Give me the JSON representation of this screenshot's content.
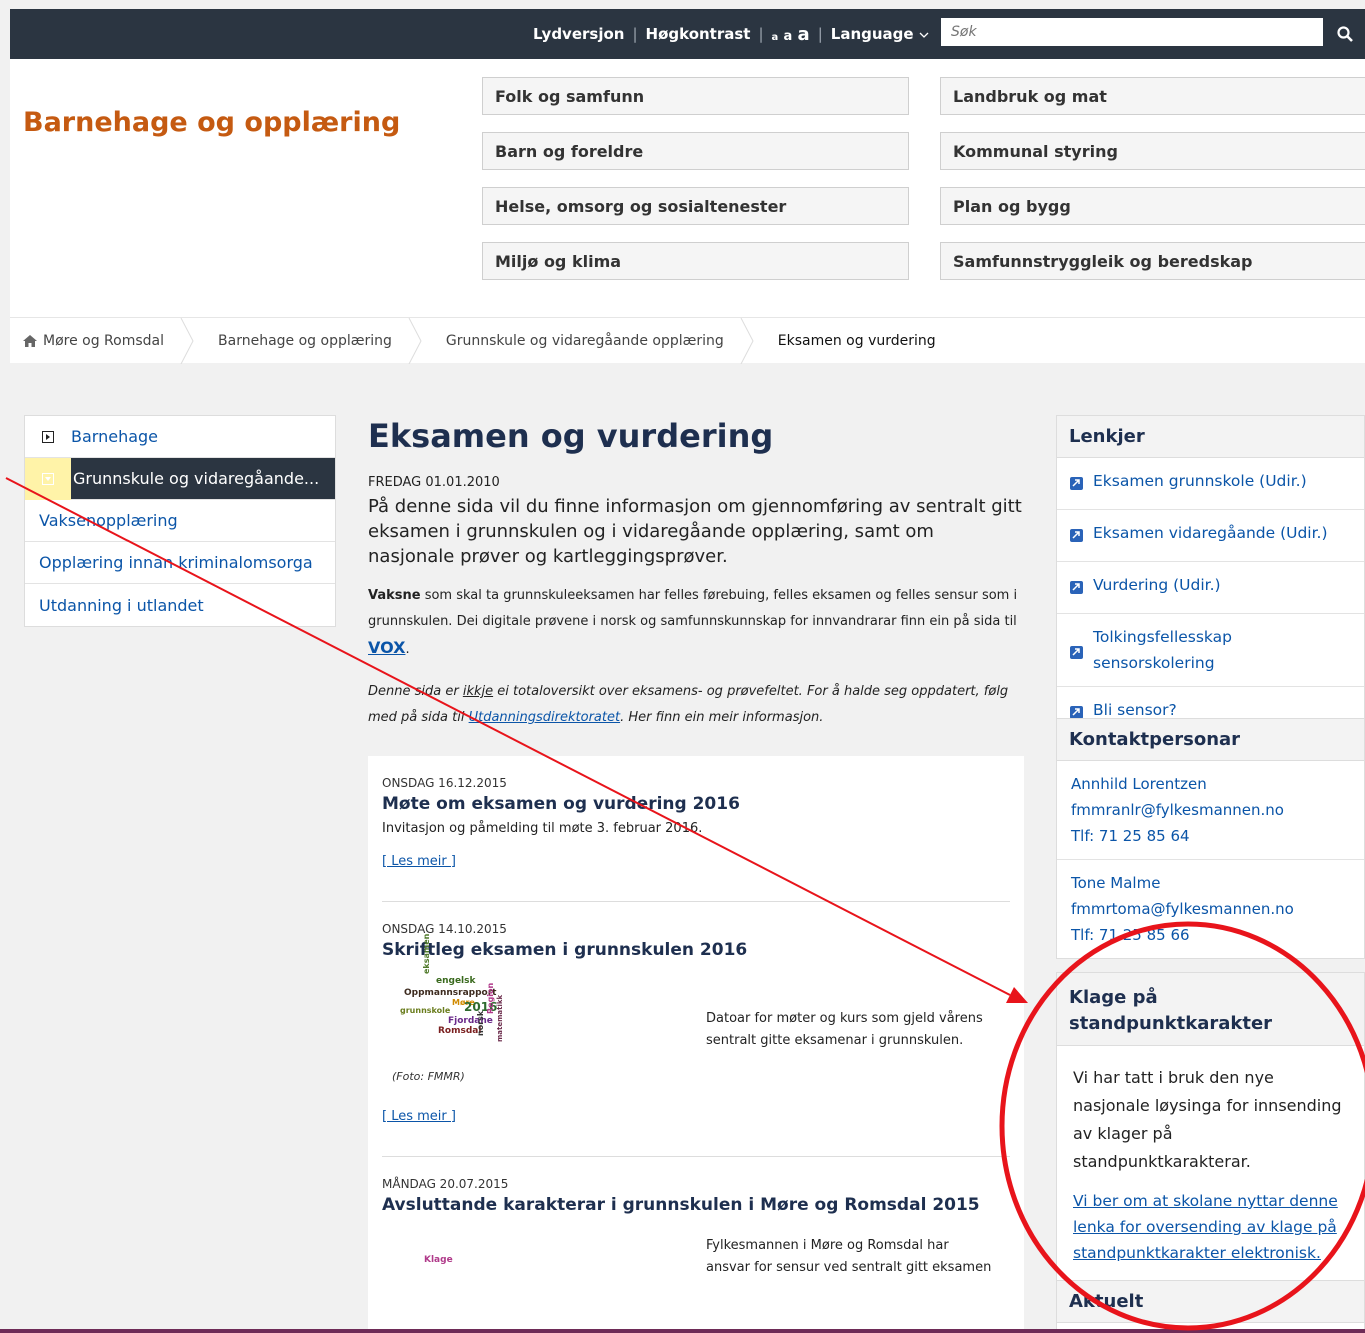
{
  "topbar": {
    "audio_version": "Lydversjon",
    "high_contrast": "Høgkontrast",
    "text_size_small": "a",
    "text_size_medium": "a",
    "text_size_large": "a",
    "language": "Language",
    "search_placeholder": "Søk"
  },
  "header": {
    "site_title": "Barnehage og opplæring",
    "nav_left": [
      "Folk og samfunn",
      "Barn og foreldre",
      "Helse, omsorg og sosialtenester",
      "Miljø og klima"
    ],
    "nav_right": [
      "Landbruk og mat",
      "Kommunal styring",
      "Plan og bygg",
      "Samfunnstryggleik og beredskap"
    ]
  },
  "breadcrumb": [
    "Møre og Romsdal",
    "Barnehage og opplæring",
    "Grunnskule og vidaregåande opplæring",
    "Eksamen og vurdering"
  ],
  "leftnav": [
    "Barnehage",
    "Grunnskule og vidaregåande...",
    "Vaksenopplæring",
    "Opplæring innan kriminalomsorga",
    "Utdanning i utlandet"
  ],
  "main": {
    "title": "Eksamen og vurdering",
    "date": "FREDAG 01.01.2010",
    "lead": "På denne sida vil du finne informasjon om gjennomføring av sentralt gitt eksamen i grunnskulen og i vidaregåande opplæring, samt om nasjonale prøver og kartleggingsprøver.",
    "p1_bold": "Vaksne",
    "p1_text": " som skal ta grunnskuleeksamen har felles førebuing, felles eksamen og felles sensur som i grunnskulen. Dei digitale prøvene i norsk og samfunnskunnskap for innvandrarar finn ein på sida til ",
    "p1_link": "VOX",
    "p1_end": ".",
    "p2_a": "Denne sida er ",
    "p2_ikkje": "ikkje",
    "p2_b": " ei totaloversikt over eksamens- og prøvefeltet. For å halde seg oppdatert, følg med på sida til ",
    "p2_link": "Utdanningsdirektoratet",
    "p2_c": ". Her finn ein meir informasjon."
  },
  "news": [
    {
      "date": "ONSDAG 16.12.2015",
      "title": "Møte om eksamen og vurdering 2016",
      "text": "Invitasjon og påmelding til møte 3. februar 2016.",
      "more": "[ Les meir ]"
    },
    {
      "date": "ONSDAG 14.10.2015",
      "title": "Skriftleg eksamen i grunnskulen 2016",
      "image_text": "Datoar for møter og kurs som gjeld vårens sentralt gitte eksamenar i grunnskulen.",
      "caption": "(Foto: FMMR)",
      "more": "[ Les meir ]"
    },
    {
      "date": "MÅNDAG 20.07.2015",
      "title": "Avsluttande karakterar i grunnskulen i Møre og Romsdal 2015",
      "image_text": "Fylkesmannen i Møre og Romsdal har ansvar for sensur ved sentralt gitt eksamen"
    }
  ],
  "wordcloud": [
    "engelsk",
    "Oppmannsrapport",
    "Møre",
    "grunnskole",
    "Fjordane",
    "Romsdal",
    "2016",
    "eksamen",
    "norsk",
    "Region",
    "matematikk"
  ],
  "wordcloud2": "Klage",
  "lenkjer": {
    "title": "Lenkjer",
    "links": [
      "Eksamen grunnskole (Udir.)",
      "Eksamen vidaregåande (Udir.)",
      "Vurdering (Udir.)",
      "Tolkingsfellesskap sensorskolering",
      "Bli sensor?"
    ]
  },
  "kontakt": {
    "title": "Kontaktpersonar",
    "people": [
      {
        "name": "Annhild Lorentzen",
        "email": "fmmranlr@fylkesmannen.no",
        "phone": "Tlf: 71 25 85 64"
      },
      {
        "name": "Tone Malme",
        "email": "fmmrtoma@fylkesmannen.no",
        "phone": "Tlf: 71 25 85 66"
      }
    ]
  },
  "klage": {
    "title": "Klage på standpunktkarakter",
    "text": "Vi har tatt i bruk den nye nasjonale løysinga for innsending av klager på standpunktkarakterar.",
    "link": "Vi ber om at skolane nyttar denne lenka for oversending av klage på standpunktkarakter elektronisk."
  },
  "aktuelt": {
    "title": "Aktuelt"
  },
  "colors": {
    "topbar": "#2b3541",
    "brand": "#c55a11",
    "title": "#1e2f4f",
    "link": "#0b55a8",
    "annotation": "#e8141b"
  },
  "icons": [
    "search-icon",
    "chevron-down-icon",
    "home-icon",
    "expand-icon",
    "collapse-icon",
    "external-link-icon"
  ]
}
